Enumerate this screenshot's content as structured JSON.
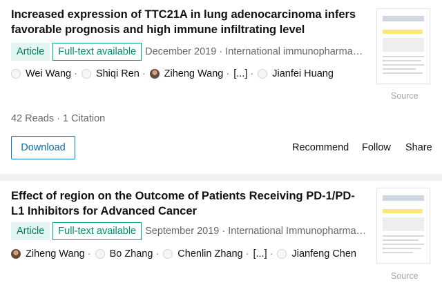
{
  "papers": [
    {
      "title": "Increased expression of TTC21A in lung adenocarcinoma infers favorable prognosis and high immune infiltrating level",
      "type_label": "Article",
      "fulltext_label": "Full-text available",
      "meta": "December 2019 · International immunopharmacol...",
      "authors": [
        {
          "name": "Wei Wang",
          "avatar": "placeholder"
        },
        {
          "name": "Shiqi Ren",
          "avatar": "placeholder"
        },
        {
          "name": "Ziheng Wang",
          "avatar": "photo"
        },
        {
          "name": "[...]",
          "avatar": "none"
        },
        {
          "name": "Jianfei Huang",
          "avatar": "placeholder"
        }
      ],
      "source_label": "Source",
      "stats": "42 Reads · 1 Citation",
      "actions": {
        "download": "Download",
        "recommend": "Recommend",
        "follow": "Follow",
        "share": "Share"
      }
    },
    {
      "title": "Effect of region on the Outcome of Patients Receiving PD-1/PD-L1 Inhibitors for Advanced Cancer",
      "type_label": "Article",
      "fulltext_label": "Full-text available",
      "meta": "September 2019 · International Immunopharmacol...",
      "authors": [
        {
          "name": "Ziheng Wang",
          "avatar": "photo"
        },
        {
          "name": "Bo Zhang",
          "avatar": "placeholder"
        },
        {
          "name": "Chenlin Zhang",
          "avatar": "placeholder"
        },
        {
          "name": "[...]",
          "avatar": "none"
        },
        {
          "name": "Jianfeng Chen",
          "avatar": "placeholder"
        }
      ],
      "source_label": "Source"
    }
  ],
  "colors": {
    "accent_green": "#00a57d",
    "link_blue": "#0a7bc0",
    "badge_bg": "#e2f5f0"
  }
}
